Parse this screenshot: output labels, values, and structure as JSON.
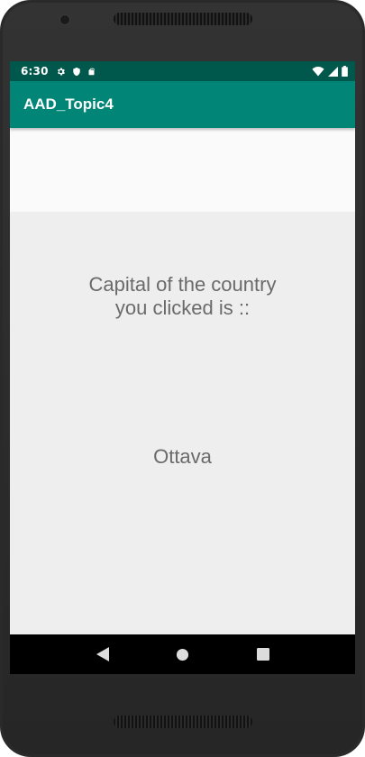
{
  "status_bar": {
    "time": "6:30",
    "icons_left": [
      "gear-icon",
      "shield-icon",
      "sd-card-icon"
    ],
    "icons_right": [
      "wifi-icon",
      "signal-icon",
      "battery-icon"
    ]
  },
  "app_bar": {
    "title": "AAD_Topic4",
    "color": "#008577"
  },
  "main": {
    "caption": "Capital of the country\nyou clicked is ::",
    "capital": "Ottava"
  },
  "nav_bar": {
    "buttons": [
      "back-icon",
      "home-icon",
      "recents-icon"
    ]
  },
  "colors": {
    "status_bar": "#00574b",
    "app_bar": "#008577",
    "background": "#eeeeee",
    "text": "#6a6a6a"
  }
}
